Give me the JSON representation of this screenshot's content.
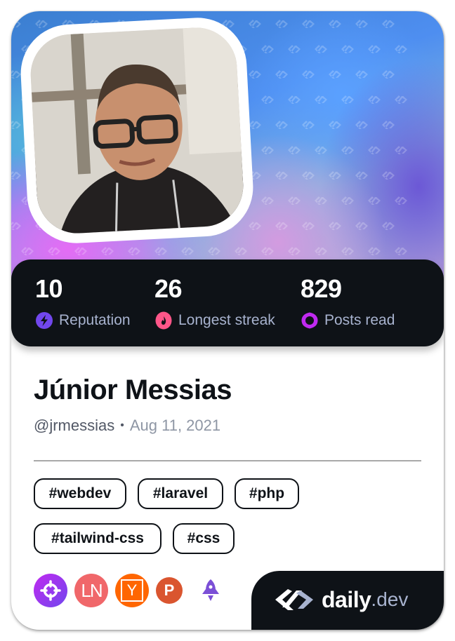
{
  "profile": {
    "name": "Júnior Messias",
    "username": "@jrmessias",
    "separator": "•",
    "joined": "Aug 11, 2021",
    "avatar_alt": "profile photo"
  },
  "stats": [
    {
      "value": "10",
      "label": "Reputation",
      "icon": "lightning-icon",
      "color": "#7147ed"
    },
    {
      "value": "26",
      "label": "Longest streak",
      "icon": "flame-icon",
      "color": "#ff5689"
    },
    {
      "value": "829",
      "label": "Posts read",
      "icon": "eye-ring-icon",
      "color": "#c029f0"
    }
  ],
  "tags": [
    "#webdev",
    "#laravel",
    "#php",
    "#tailwind-css",
    "#css"
  ],
  "sources": [
    {
      "name": "target-source",
      "glyph": "⌖",
      "color": "#a23df5"
    },
    {
      "name": "laravel-news",
      "glyph": "LN",
      "color": "#f0676a"
    },
    {
      "name": "hacker-news",
      "glyph": "Y",
      "color": "#ff6600"
    },
    {
      "name": "product-hunt",
      "glyph": "P",
      "color": "#da552f"
    },
    {
      "name": "rocket-source",
      "glyph": "rocket",
      "color": "#7b4fd6"
    }
  ],
  "brand": {
    "daily": "daily",
    "dev": ".dev"
  },
  "colors": {
    "stats_bg": "#0e1217",
    "label": "#a8b3cf",
    "text": "#0e1217"
  }
}
